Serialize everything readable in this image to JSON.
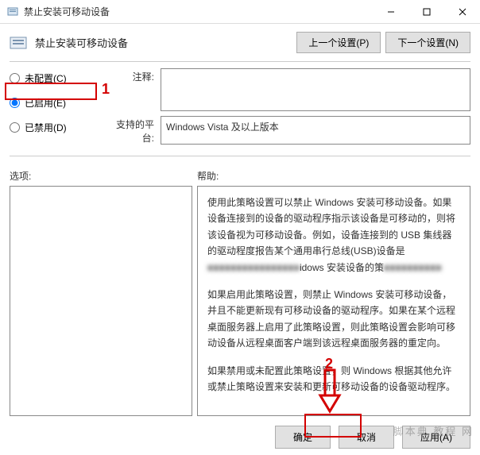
{
  "window": {
    "title": "禁止安装可移动设备",
    "header_title": "禁止安装可移动设备",
    "prev_label": "上一个设置(P)",
    "next_label": "下一个设置(N)"
  },
  "radios": {
    "not_configured": "未配置(C)",
    "enabled": "已启用(E)",
    "disabled": "已禁用(D)"
  },
  "fields": {
    "comment_label": "注释:",
    "platform_label": "支持的平台:",
    "platform_value": "Windows Vista 及以上版本"
  },
  "sections": {
    "options_label": "选项:",
    "help_label": "帮助:"
  },
  "help": {
    "p1_a": "使用此策略设置可以禁止 Windows 安装可移动设备。如果设备连接到的设备的驱动程序指示该设备是可移动的，则将该设备视为可移动设备。例如，设备连接到的 USB 集线器的驱动程度报告某个通用串行总线(USB)设备是",
    "p1_blur": "■■■■■■■■■■■■■■■■",
    "p1_b": "idows 安装设备的策",
    "p1_blur2": "■■■■■■■■■■",
    "p2": "如果启用此策略设置，则禁止 Windows 安装可移动设备，并且不能更新现有可移动设备的驱动程序。如果在某个远程桌面服务器上启用了此策略设置，则此策略设置会影响可移动设备从远程桌面客户端到该远程桌面服务器的重定向。",
    "p3": "如果禁用或未配置此策略设置，则 Windows 根据其他允许或禁止策略设置来安装和更新可移动设备的设备驱动程序。"
  },
  "buttons": {
    "ok": "确定",
    "cancel": "取消",
    "apply": "应用(A)"
  },
  "annotations": {
    "one": "1",
    "two": "2"
  },
  "watermark": "脚本典  教程  网"
}
